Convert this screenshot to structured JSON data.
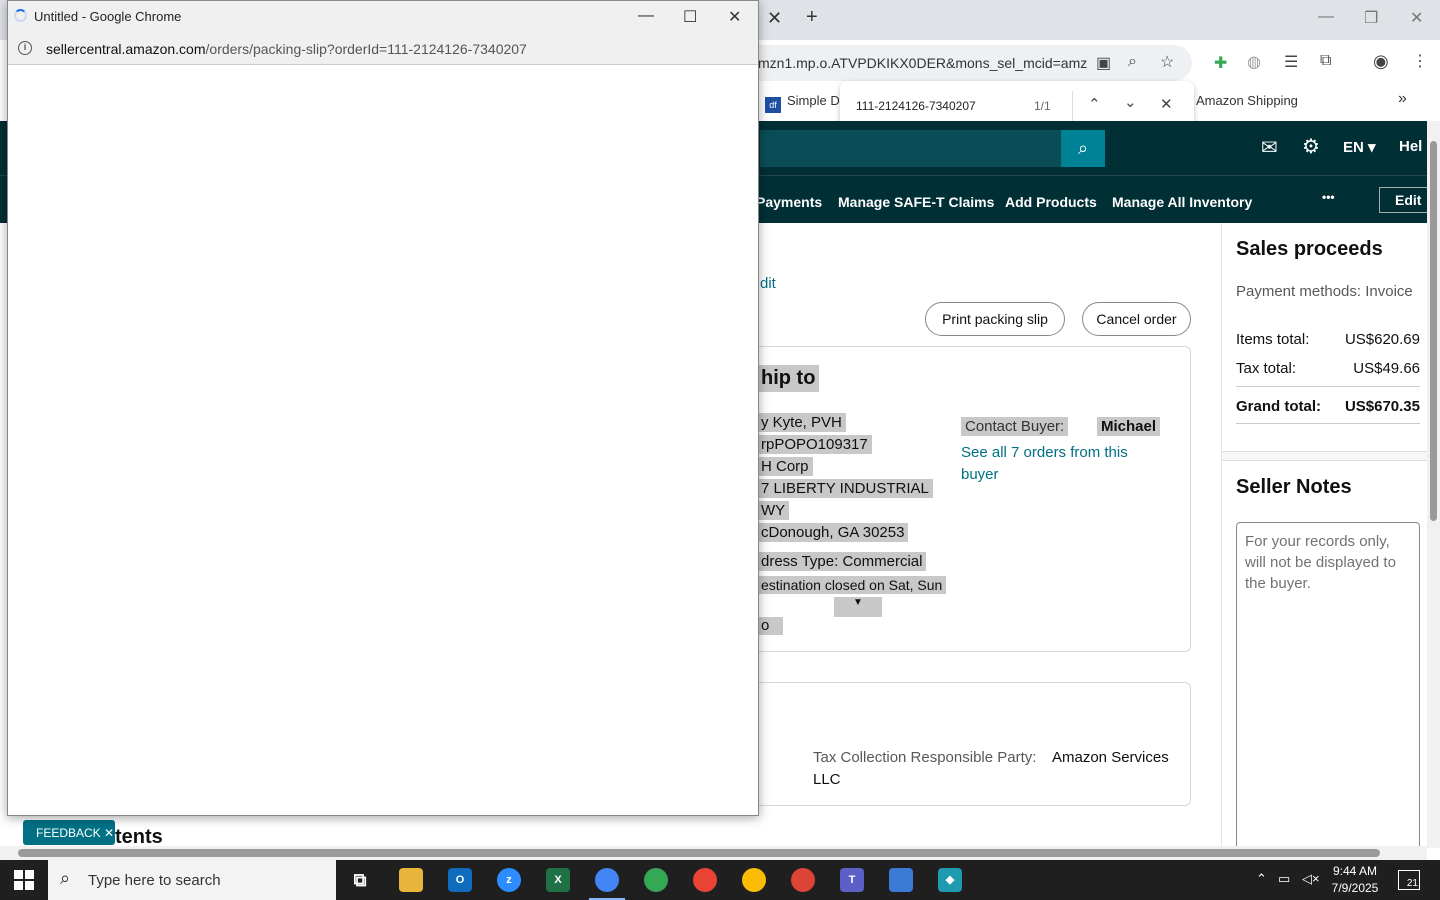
{
  "background_browser": {
    "address_partial": "mzn1.mp.o.ATVPDKIKX0DER&mons_sel_mcid=amz...",
    "bookmarks": [
      {
        "label": "Simple Da",
        "favicon": "df"
      },
      {
        "label": "Amazon Shipping"
      }
    ],
    "find_bar": {
      "query": "111-2124126-7340207",
      "count": "1/1"
    },
    "nav": {
      "language": "EN",
      "help_partial": "Hel"
    },
    "menu": [
      "Payments",
      "Manage SAFE-T Claims",
      "Add Products",
      "Manage All Inventory"
    ],
    "menu_more": "•••",
    "edit_label": "Edit"
  },
  "order": {
    "edit_link_partial": "dit",
    "print_packing_slip": "Print packing slip",
    "cancel_order": "Cancel order",
    "ship_to_heading_partial": "hip to",
    "address_lines": [
      "y Kyte, PVH",
      "rpPOPO109317",
      "H Corp",
      "7 LIBERTY INDUSTRIAL",
      "WY",
      "cDonough, GA 30253"
    ],
    "address_type_label": "dress Type:",
    "address_type_value": "Commercial",
    "destination_note": "estination closed on Sat, Sun",
    "extra_partial": "o",
    "contact_buyer_label": "Contact Buyer:",
    "contact_buyer_name": "Michael",
    "see_orders_link_1": "See all 7 orders from this",
    "see_orders_link_2": "buyer",
    "tax_party_label": "Tax Collection Responsible Party:",
    "tax_party_value_1": "Amazon Services",
    "tax_party_value_2": "LLC",
    "contents_heading_partial": "tents"
  },
  "sidebar": {
    "sales_heading": "Sales proceeds",
    "payment_methods": "Payment methods: Invoice",
    "items_total_label": "Items total:",
    "items_total_value": "US$620.69",
    "tax_total_label": "Tax total:",
    "tax_total_value": "US$49.66",
    "grand_total_label": "Grand total:",
    "grand_total_value": "US$670.35",
    "notes_heading": "Seller Notes",
    "notes_placeholder": "For your records only, will not be displayed to the buyer."
  },
  "popup": {
    "title": "Untitled - Google Chrome",
    "url_host": "sellercentral.amazon.com",
    "url_path": "/orders/packing-slip?orderId=111-2124126-7340207"
  },
  "feedback_label": "FEEDBACK",
  "taskbar": {
    "search_placeholder": "Type here to search",
    "time": "9:44 AM",
    "date": "7/9/2025",
    "notification_count": "21"
  }
}
